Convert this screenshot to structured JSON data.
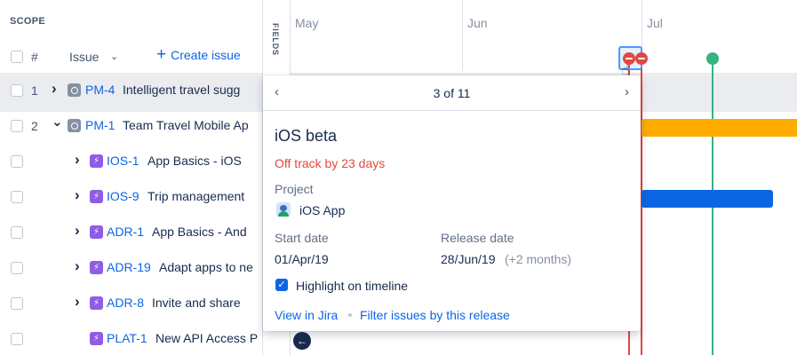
{
  "scope": {
    "title": "SCOPE",
    "header": {
      "hash": "#",
      "issue": "Issue",
      "create_label": "Create issue"
    },
    "rows": [
      {
        "num": "1",
        "key": "PM-4",
        "title": "Intelligent travel sugg",
        "type": "epic",
        "expand": "collapsed",
        "selected": true
      },
      {
        "num": "2",
        "key": "PM-1",
        "title": "Team Travel Mobile Ap",
        "type": "epic",
        "expand": "expanded",
        "selected": false
      },
      {
        "num": "",
        "key": "IOS-1",
        "title": "App Basics - iOS",
        "type": "story",
        "expand": "collapsed",
        "selected": false
      },
      {
        "num": "",
        "key": "IOS-9",
        "title": "Trip management",
        "type": "story",
        "expand": "collapsed",
        "selected": false
      },
      {
        "num": "",
        "key": "ADR-1",
        "title": "App Basics - And",
        "type": "story",
        "expand": "collapsed",
        "selected": false
      },
      {
        "num": "",
        "key": "ADR-19",
        "title": "Adapt apps to ne",
        "type": "story",
        "expand": "collapsed",
        "selected": false
      },
      {
        "num": "",
        "key": "ADR-8",
        "title": "Invite and share",
        "type": "story",
        "expand": "collapsed",
        "selected": false
      },
      {
        "num": "",
        "key": "PLAT-1",
        "title": "New API Access P",
        "type": "story",
        "expand": "none",
        "selected": false
      }
    ]
  },
  "fields": {
    "label": "FIELDS"
  },
  "timeline": {
    "months": [
      "May",
      "Jun",
      "Jul"
    ]
  },
  "popover": {
    "count": "3 of 11",
    "release_name": "iOS beta",
    "status": "Off track by 23 days",
    "project_label": "Project",
    "project_name": "iOS App",
    "start_label": "Start date",
    "start_value": "01/Apr/19",
    "release_label": "Release date",
    "release_value": "28/Jun/19",
    "release_extra": "(+2 months)",
    "highlight_label": "Highlight on timeline",
    "highlight_checked": true,
    "view_link": "View in Jira",
    "filter_link": "Filter issues by this release"
  },
  "colors": {
    "accent": "#0c66e4",
    "off_track": "#e2483d",
    "on_track": "#36b37e",
    "epic_bar": "#ffab00",
    "story_bar": "#0c66e4",
    "story_icon": "#8f5ce5"
  }
}
